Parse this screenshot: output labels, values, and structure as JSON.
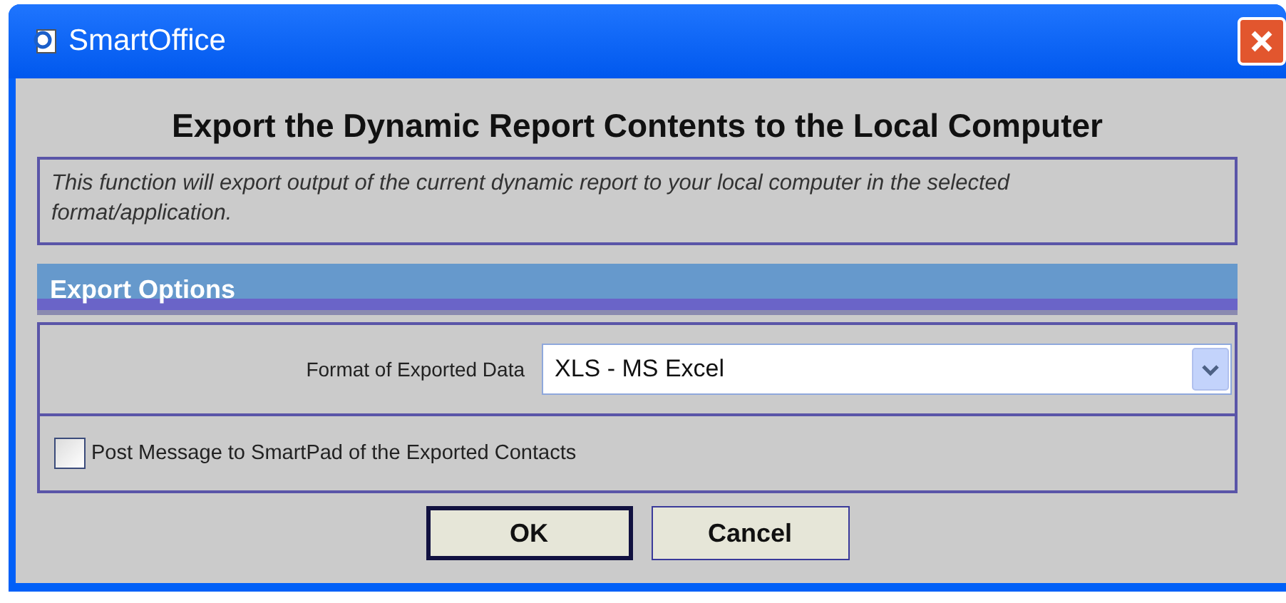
{
  "window": {
    "title": "SmartOffice"
  },
  "heading": "Export the Dynamic Report Contents to the Local Computer",
  "description": "This function will export output of the current dynamic report to your local computer in the selected format/application.",
  "export_options": {
    "title": "Export Options",
    "format": {
      "label": "Format of Exported Data",
      "value": "XLS - MS Excel"
    },
    "post_message": {
      "label": "Post Message to SmartPad of the Exported Contacts",
      "checked": false
    }
  },
  "buttons": [
    {
      "label": "OK",
      "default": true
    },
    {
      "label": "Cancel",
      "default": false
    }
  ]
}
